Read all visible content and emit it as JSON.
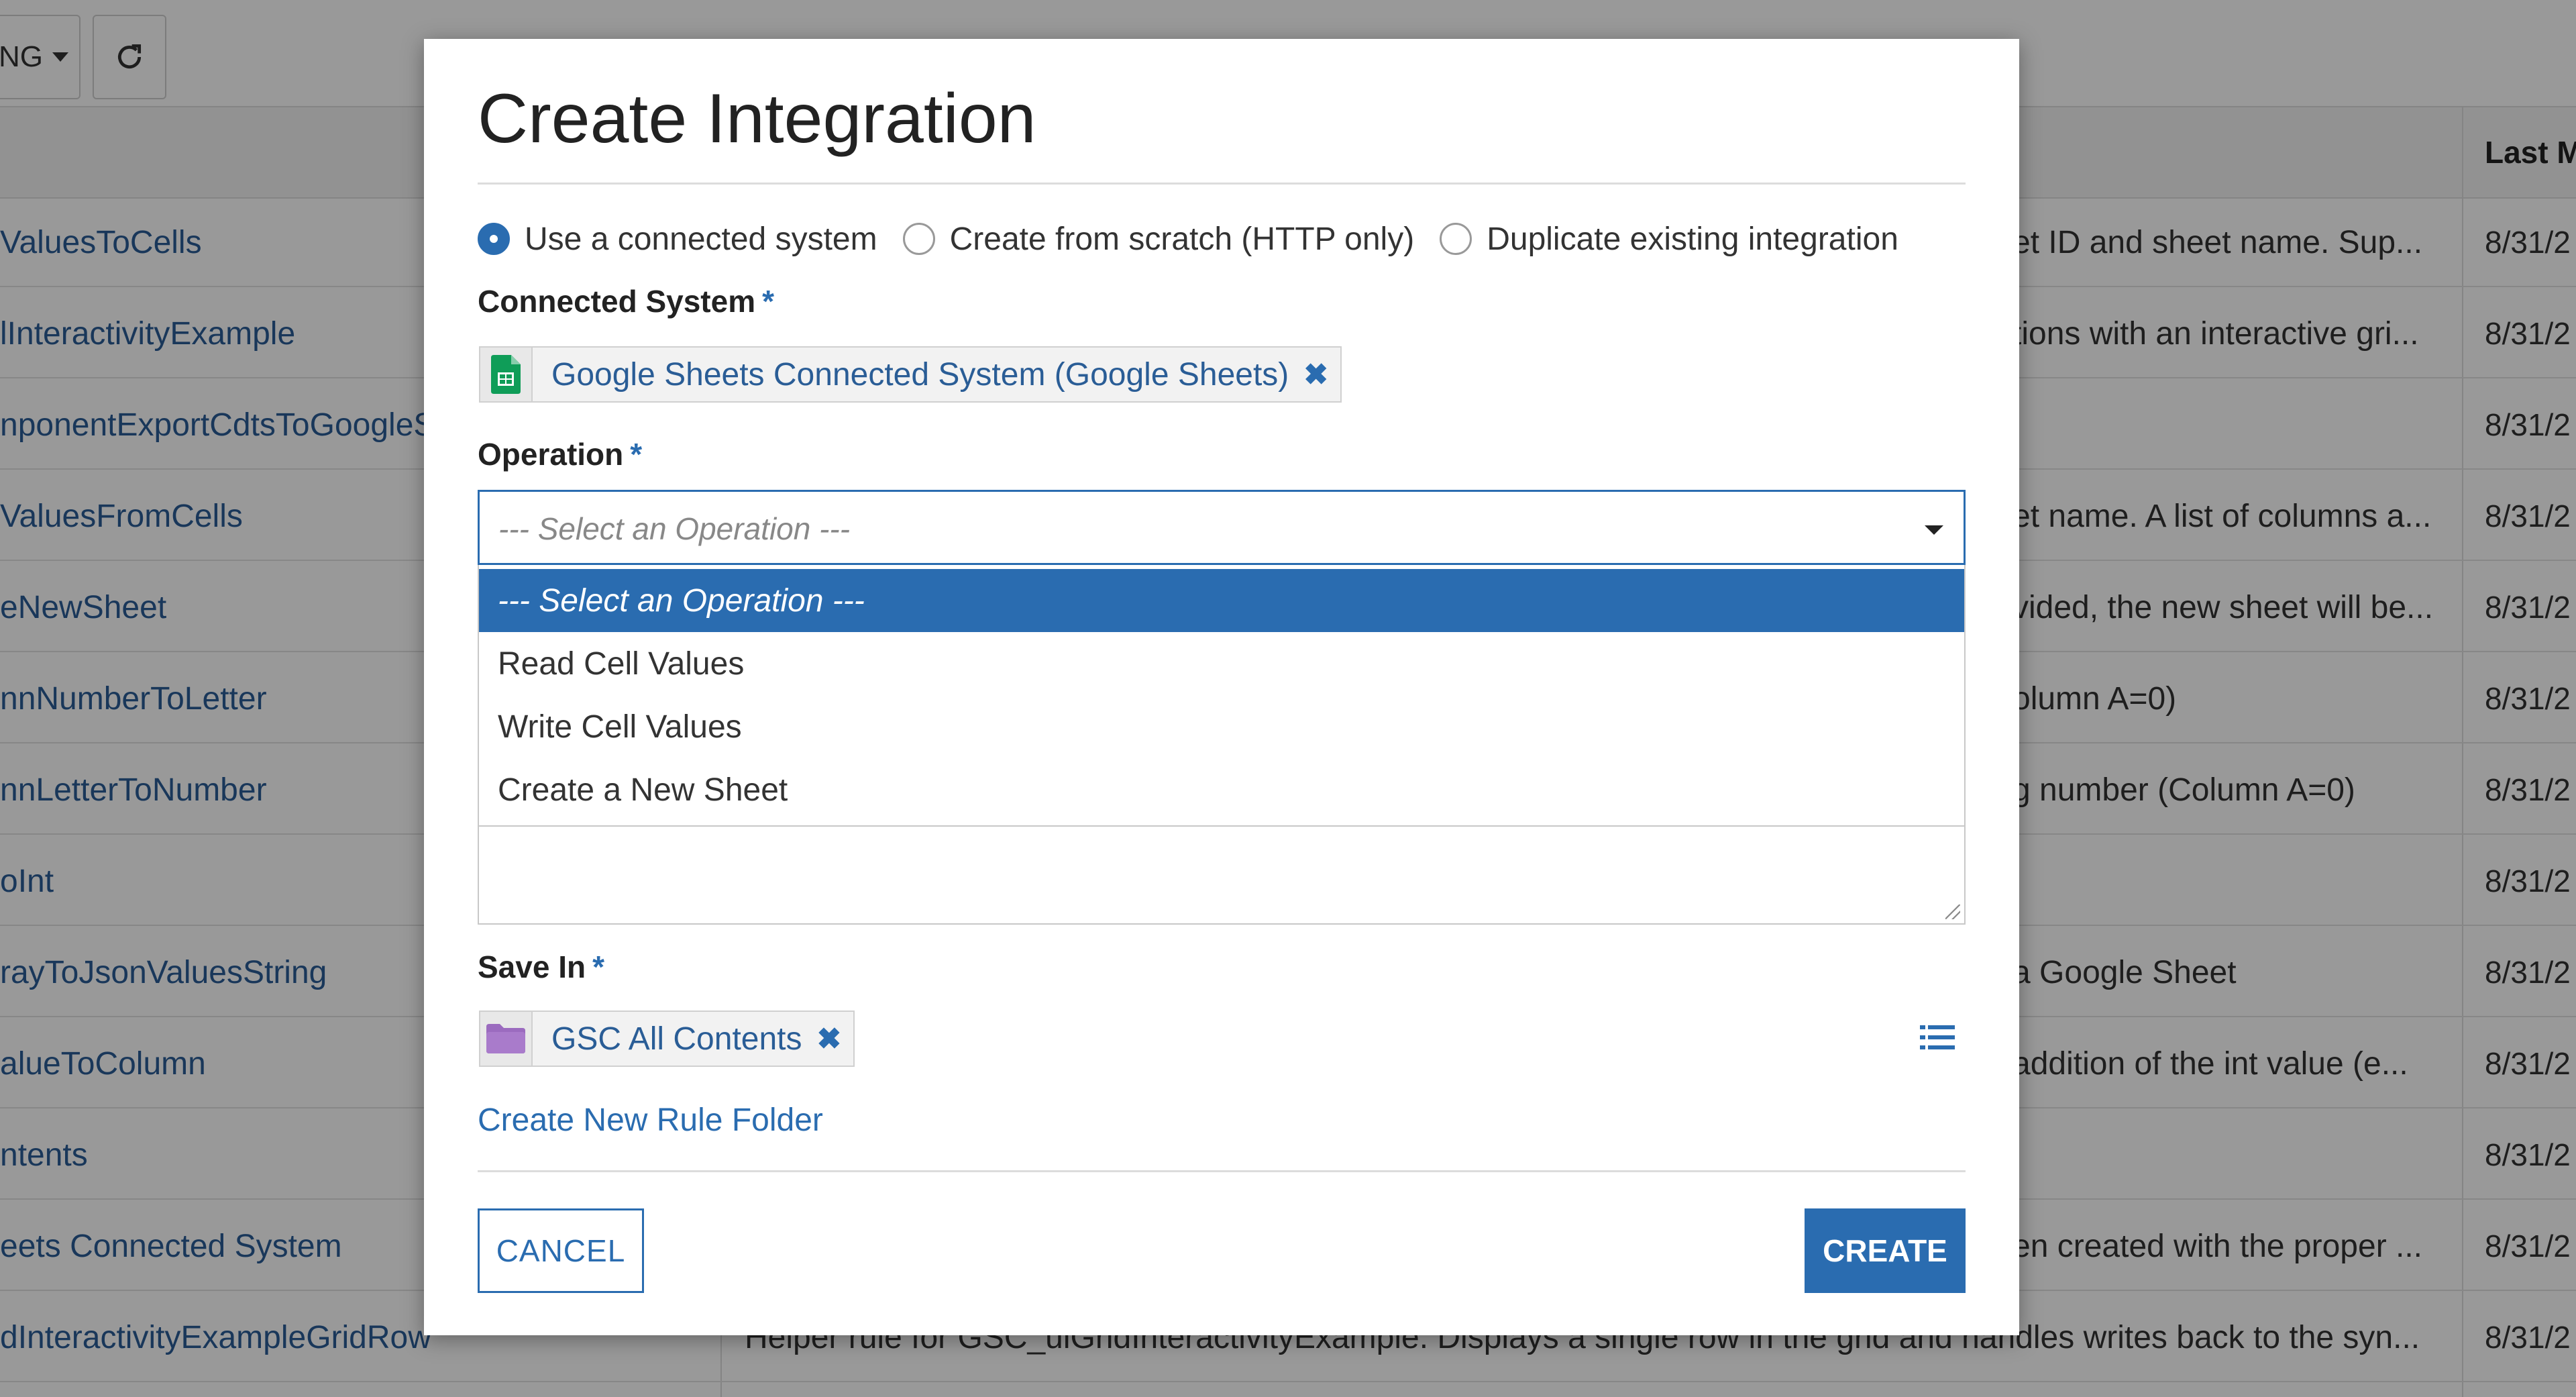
{
  "toolbar": {
    "filter_label": "NG",
    "refresh_icon": "refresh-icon"
  },
  "grid": {
    "header_last_modified": "Last M",
    "rows": [
      {
        "name": "ValuesToCells",
        "desc": "et ID and sheet name. Sup...",
        "date": "8/31/2"
      },
      {
        "name": "lInteractivityExample",
        "desc": "tions with an interactive gri...",
        "date": "8/31/2"
      },
      {
        "name": "nponentExportCdtsToGoogleS",
        "desc": "",
        "date": "8/31/2"
      },
      {
        "name": "ValuesFromCells",
        "desc": "et name. A list of columns a...",
        "date": "8/31/2"
      },
      {
        "name": "eNewSheet",
        "desc": "vided, the new sheet will be...",
        "date": "8/31/2"
      },
      {
        "name": "nnNumberToLetter",
        "desc": "olumn A=0)",
        "date": "8/31/2"
      },
      {
        "name": "nnLetterToNumber",
        "desc": "g number (Column A=0)",
        "date": "8/31/2"
      },
      {
        "name": "oInt",
        "desc": "",
        "date": "8/31/2"
      },
      {
        "name": "rayToJsonValuesString",
        "desc": "a Google Sheet",
        "date": "8/31/2"
      },
      {
        "name": "alueToColumn",
        "desc": "addition of the int value (e...",
        "date": "8/31/2"
      },
      {
        "name": "ntents",
        "desc": "",
        "date": "8/31/2"
      },
      {
        "name": "eets Connected System",
        "desc": "en created with the proper ...",
        "date": "8/31/2"
      },
      {
        "name": "dInteractivityExampleGridRow",
        "desc": "Helper rule for GSC_uiGridInteractivityExample. Displays a single row in the grid and handles writes back to the syn...",
        "date": "8/31/2"
      }
    ]
  },
  "modal": {
    "title": "Create Integration",
    "radio_options": [
      {
        "label": "Use a connected system",
        "selected": true
      },
      {
        "label": "Create from scratch (HTTP only)",
        "selected": false
      },
      {
        "label": "Duplicate existing integration",
        "selected": false
      }
    ],
    "connected_system": {
      "label": "Connected System",
      "required_mark": "*",
      "value": "Google Sheets Connected System (Google Sheets)",
      "icon": "google-sheets-icon"
    },
    "operation": {
      "label": "Operation",
      "required_mark": "*",
      "selected_value": "--- Select an Operation ---",
      "options": [
        "--- Select an Operation ---",
        "Read Cell Values",
        "Write Cell Values",
        "Create a New Sheet"
      ]
    },
    "save_in": {
      "label": "Save In",
      "required_mark": "*",
      "value": "GSC All Contents",
      "icon": "folder-icon"
    },
    "create_folder_link": "Create New Rule Folder",
    "cancel_label": "CANCEL",
    "create_label": "CREATE"
  },
  "colors": {
    "accent": "#2a6cb0",
    "link": "#2a5d96",
    "sheets_green": "#0f9d58",
    "folder_purple": "#9b6bbf"
  }
}
